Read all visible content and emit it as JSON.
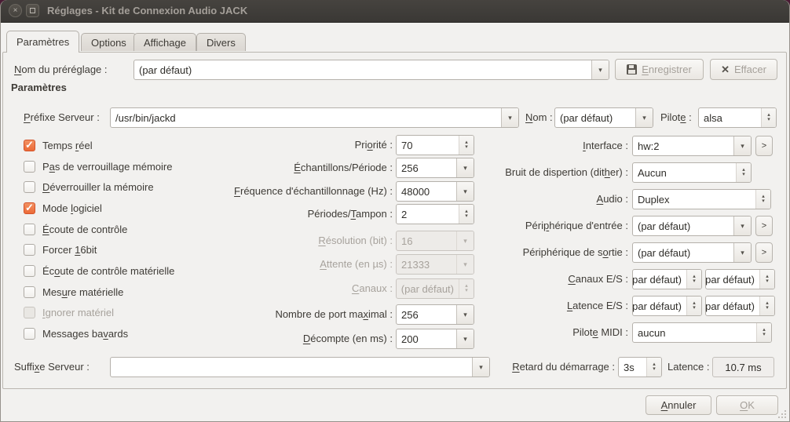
{
  "window": {
    "title": "Réglages - Kit de Connexion Audio JACK"
  },
  "icons": {
    "close": "×",
    "dropdown": "▾",
    "spin_up": "▴",
    "spin_down": "▾",
    "more": ">",
    "check": "✓",
    "clear": "✕"
  },
  "tabs": [
    {
      "label": "Paramètres",
      "active": true
    },
    {
      "label": "Options",
      "active": false
    },
    {
      "label": "Affichage",
      "active": false
    },
    {
      "label": "Divers",
      "active": false
    }
  ],
  "preset_row": {
    "label": "&Nom du préréglage :",
    "value": "(par défaut)",
    "save_label": "&Enregistrer",
    "save_disabled": true,
    "clear_label": "Effacer",
    "clear_disabled": true
  },
  "section_title": "Paramètres",
  "server_row": {
    "prefix_label": "&Préfixe Serveur :",
    "prefix_value": "/usr/bin/jackd",
    "name_label": "&Nom :",
    "name_value": "(par défaut)",
    "driver_label": "Pilot&e :",
    "driver_value": "alsa"
  },
  "checkboxes": [
    {
      "label": "Temps &réel",
      "checked": true,
      "disabled": false
    },
    {
      "label": "P&as de verrouillage mémoire",
      "checked": false,
      "disabled": false
    },
    {
      "label": "&Déverrouiller la mémoire",
      "checked": false,
      "disabled": false
    },
    {
      "label": "Mode &logiciel",
      "checked": true,
      "disabled": false
    },
    {
      "label": "&Écoute de contrôle",
      "checked": false,
      "disabled": false
    },
    {
      "label": "Forcer &16bit",
      "checked": false,
      "disabled": false
    },
    {
      "label": "Éc&oute de contrôle matérielle",
      "checked": false,
      "disabled": false
    },
    {
      "label": "Mes&ure matérielle",
      "checked": false,
      "disabled": false
    },
    {
      "label": "&Ignorer matériel",
      "checked": false,
      "disabled": true
    },
    {
      "label": "Messages ba&vards",
      "checked": false,
      "disabled": false
    }
  ],
  "mid_fields": [
    {
      "label": "Pri&orité :",
      "value": "70",
      "type": "spin",
      "disabled": false
    },
    {
      "label": "&Échantillons/Période :",
      "value": "256",
      "type": "combo",
      "disabled": false
    },
    {
      "label": "&Fréquence d'échantillonnage (Hz) :",
      "value": "48000",
      "type": "combo",
      "disabled": false
    },
    {
      "label": "Périodes/&Tampon :",
      "value": "2",
      "type": "spin",
      "disabled": false
    },
    {
      "label": "&Résolution (bit) :",
      "value": "16",
      "type": "combo",
      "disabled": true
    },
    {
      "label": "&Attente (en µs) :",
      "value": "21333",
      "type": "combo",
      "disabled": true
    },
    {
      "label": "&Canaux :",
      "value": "(par défaut)",
      "type": "spin",
      "disabled": true
    },
    {
      "label": "Nombre de port ma&ximal :",
      "value": "256",
      "type": "combo",
      "disabled": false
    },
    {
      "label": "&Décompte (en ms) :",
      "value": "200",
      "type": "combo",
      "disabled": false
    }
  ],
  "right_fields": {
    "interface": {
      "label": "&Interface :",
      "value": "hw:2",
      "more": ">"
    },
    "dither": {
      "label": "Bruit de dispertion (dit&her) :",
      "value": "Aucun"
    },
    "audio": {
      "label": "&Audio :",
      "value": "Duplex"
    },
    "input_device": {
      "label": "Péri&phérique d'entrée :",
      "value": "(par défaut)",
      "more": ">"
    },
    "output_device": {
      "label": "Périphérique de s&ortie :",
      "value": "(par défaut)",
      "more": ">"
    },
    "channels": {
      "label": "&Canaux E/S :",
      "in_value": "(par défaut)",
      "out_value": "(par défaut)"
    },
    "latency": {
      "label": "&Latence E/S :",
      "in_value": "(par défaut)",
      "out_value": "(par défaut)"
    },
    "midi": {
      "label": "Pilot&e MIDI :",
      "value": "aucun"
    }
  },
  "bottom_row": {
    "suffix_label": "Suffi&xe Serveur :",
    "suffix_value": "",
    "delay_label": "&Retard du démarrage :",
    "delay_value": "3s",
    "latency_label": "Latence :",
    "latency_value": "10.7 ms"
  },
  "dialog_buttons": {
    "cancel": "&Annuler",
    "ok": "&OK",
    "ok_disabled": true
  },
  "colors": {
    "accent_orange": "#ec6a37",
    "titlebar": "#3d3b37",
    "background": "#f2f1ef"
  }
}
